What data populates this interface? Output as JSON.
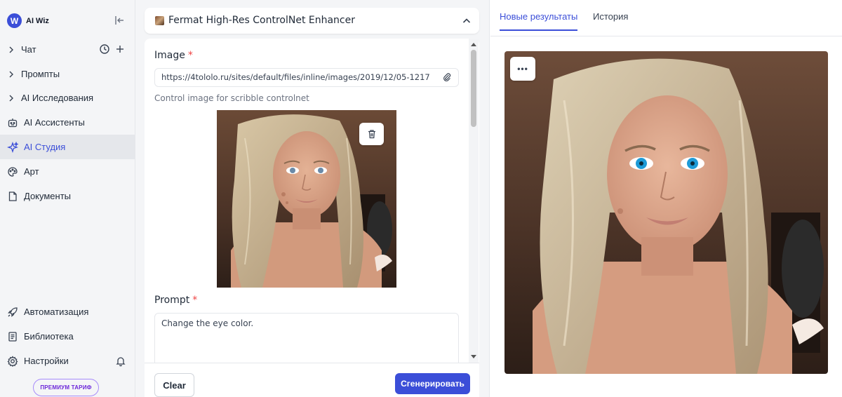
{
  "brand": {
    "name": "AI Wiz",
    "logo_letter": "W"
  },
  "sidebar": {
    "items": [
      {
        "label": "Чат",
        "icon": "chevron-right-icon"
      },
      {
        "label": "Промпты",
        "icon": "chevron-right-icon"
      },
      {
        "label": "AI Исследования",
        "icon": "chevron-right-icon"
      },
      {
        "label": "AI Ассистенты",
        "icon": "robot-icon"
      },
      {
        "label": "AI Студия",
        "icon": "sparkle-icon",
        "active": true
      },
      {
        "label": "Арт",
        "icon": "palette-icon"
      },
      {
        "label": "Документы",
        "icon": "document-icon"
      },
      {
        "label": "Автоматизация",
        "icon": "rocket-icon"
      },
      {
        "label": "Библиотека",
        "icon": "library-icon"
      },
      {
        "label": "Настройки",
        "icon": "gear-icon"
      }
    ],
    "premium_label": "ПРЕМИУМ ТАРИФ"
  },
  "model": {
    "title": "Fermat High-Res ControlNet Enhancer"
  },
  "form": {
    "image_label": "Image",
    "required_mark": "*",
    "image_url": "https://4tololo.ru/sites/default/files/inline/images/2019/12/05-1217",
    "image_helper": "Control image for scribble controlnet",
    "prompt_label": "Prompt",
    "prompt_value": "Change the eye color."
  },
  "actions": {
    "clear": "Clear",
    "generate": "Сгенерировать"
  },
  "results": {
    "tabs": [
      "Новые результаты",
      "История"
    ],
    "active_tab": "Новые результаты",
    "more_label": "•••"
  },
  "colors": {
    "accent": "#3b4ed8",
    "required": "#ef4444",
    "premium": "#6d28d9"
  }
}
